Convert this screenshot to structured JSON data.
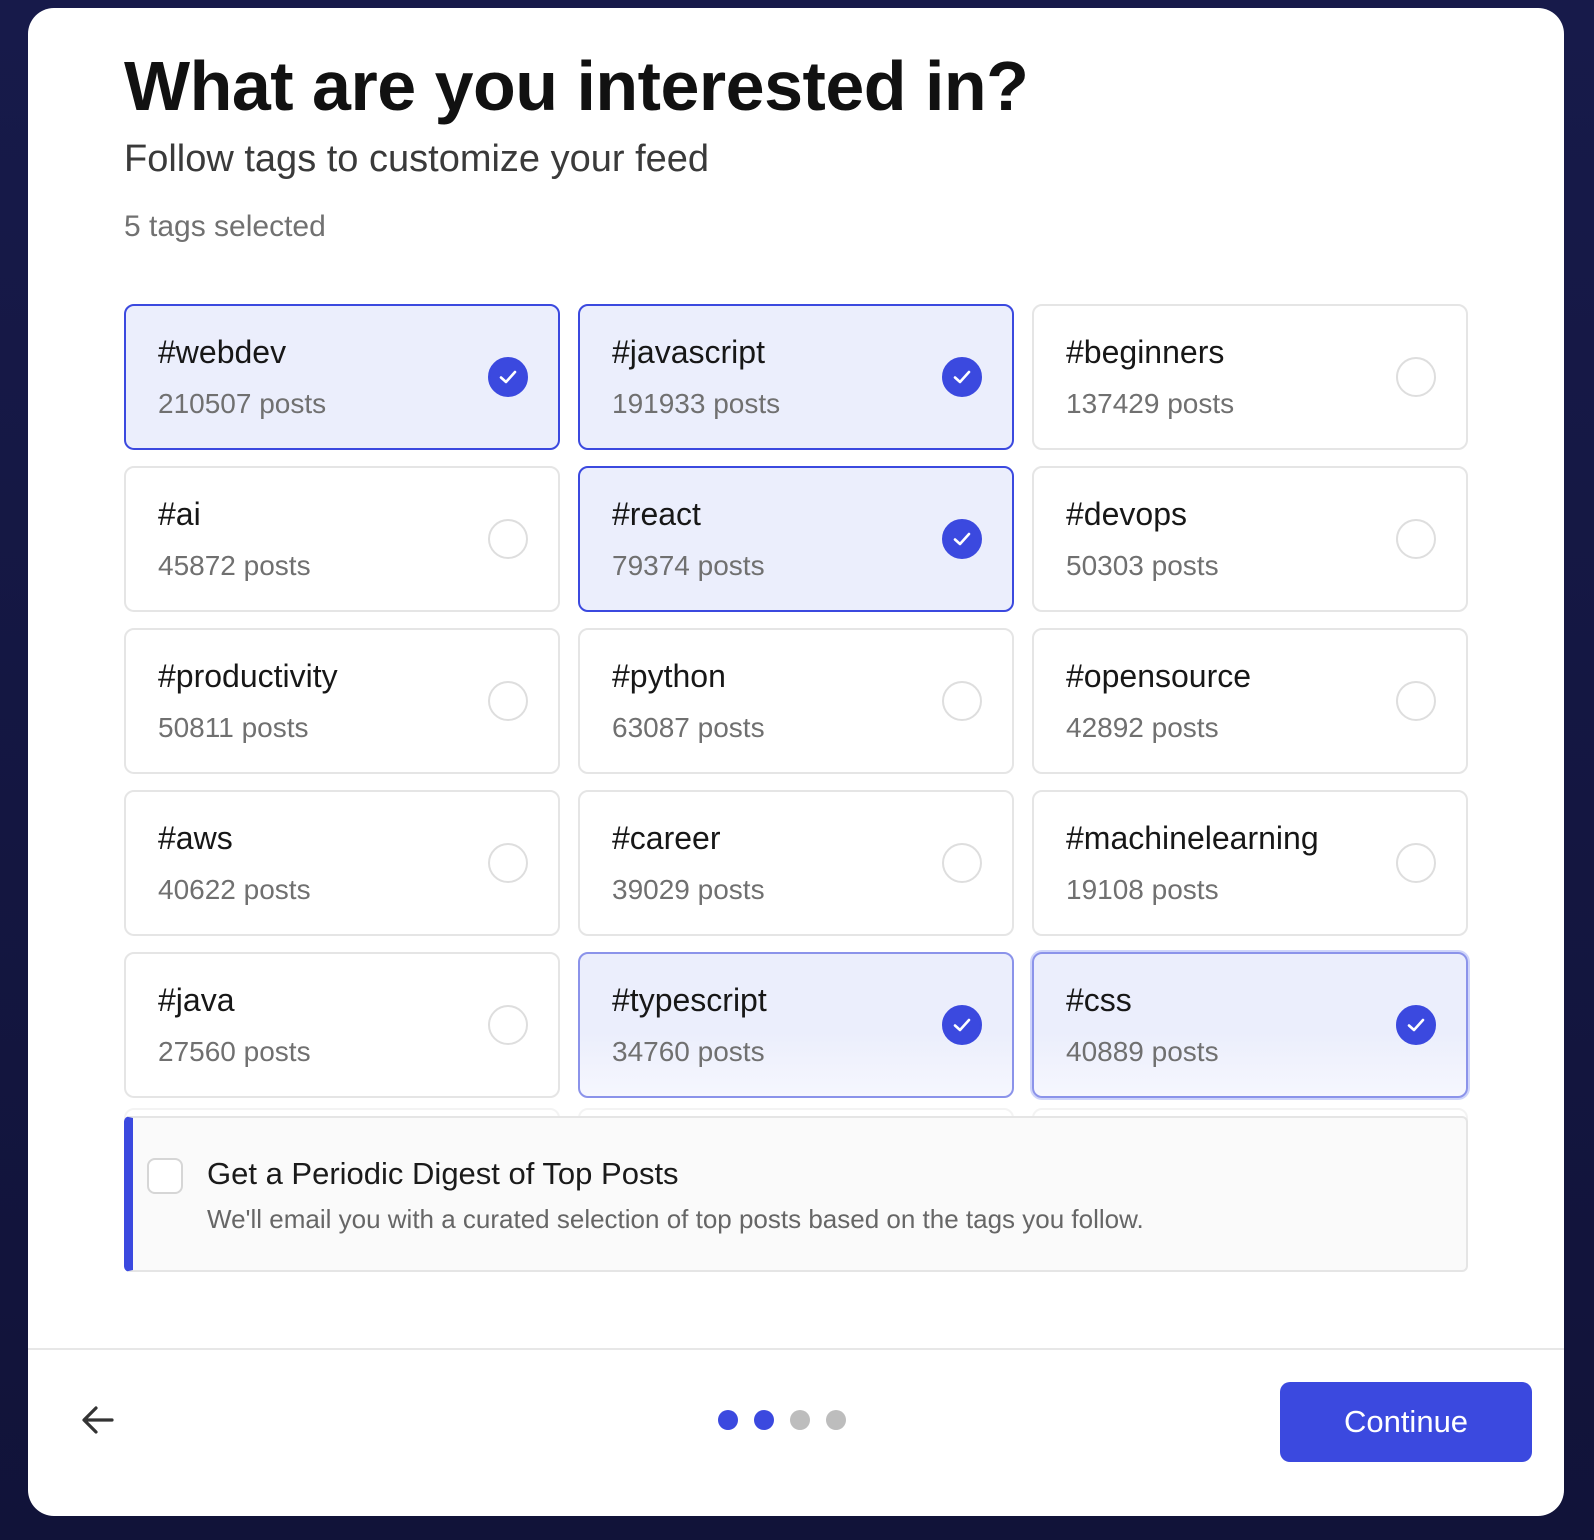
{
  "header": {
    "title": "What are you interested in?",
    "subtitle": "Follow tags to customize your feed",
    "selected_count": "5 tags selected"
  },
  "tags": [
    {
      "name": "#webdev",
      "posts": "210507 posts",
      "selected": true
    },
    {
      "name": "#javascript",
      "posts": "191933 posts",
      "selected": true
    },
    {
      "name": "#beginners",
      "posts": "137429 posts",
      "selected": false
    },
    {
      "name": "#ai",
      "posts": "45872 posts",
      "selected": false
    },
    {
      "name": "#react",
      "posts": "79374 posts",
      "selected": true
    },
    {
      "name": "#devops",
      "posts": "50303 posts",
      "selected": false
    },
    {
      "name": "#productivity",
      "posts": "50811 posts",
      "selected": false
    },
    {
      "name": "#python",
      "posts": "63087 posts",
      "selected": false
    },
    {
      "name": "#opensource",
      "posts": "42892 posts",
      "selected": false
    },
    {
      "name": "#aws",
      "posts": "40622 posts",
      "selected": false
    },
    {
      "name": "#career",
      "posts": "39029 posts",
      "selected": false
    },
    {
      "name": "#machinelearning",
      "posts": "19108 posts",
      "selected": false
    },
    {
      "name": "#java",
      "posts": "27560 posts",
      "selected": false
    },
    {
      "name": "#typescript",
      "posts": "34760 posts",
      "selected": true
    },
    {
      "name": "#css",
      "posts": "40889 posts",
      "selected": true
    }
  ],
  "digest": {
    "title": "Get a Periodic Digest of Top Posts",
    "description": "We'll email you with a curated selection of top posts based on the tags you follow.",
    "checked": false
  },
  "footer": {
    "back_icon": "arrow-left-icon",
    "continue_label": "Continue",
    "steps_total": 4,
    "steps_active": 2
  },
  "colors": {
    "accent": "#3b49df",
    "selected_bg": "#ebeefc",
    "background": "#171a4a"
  }
}
